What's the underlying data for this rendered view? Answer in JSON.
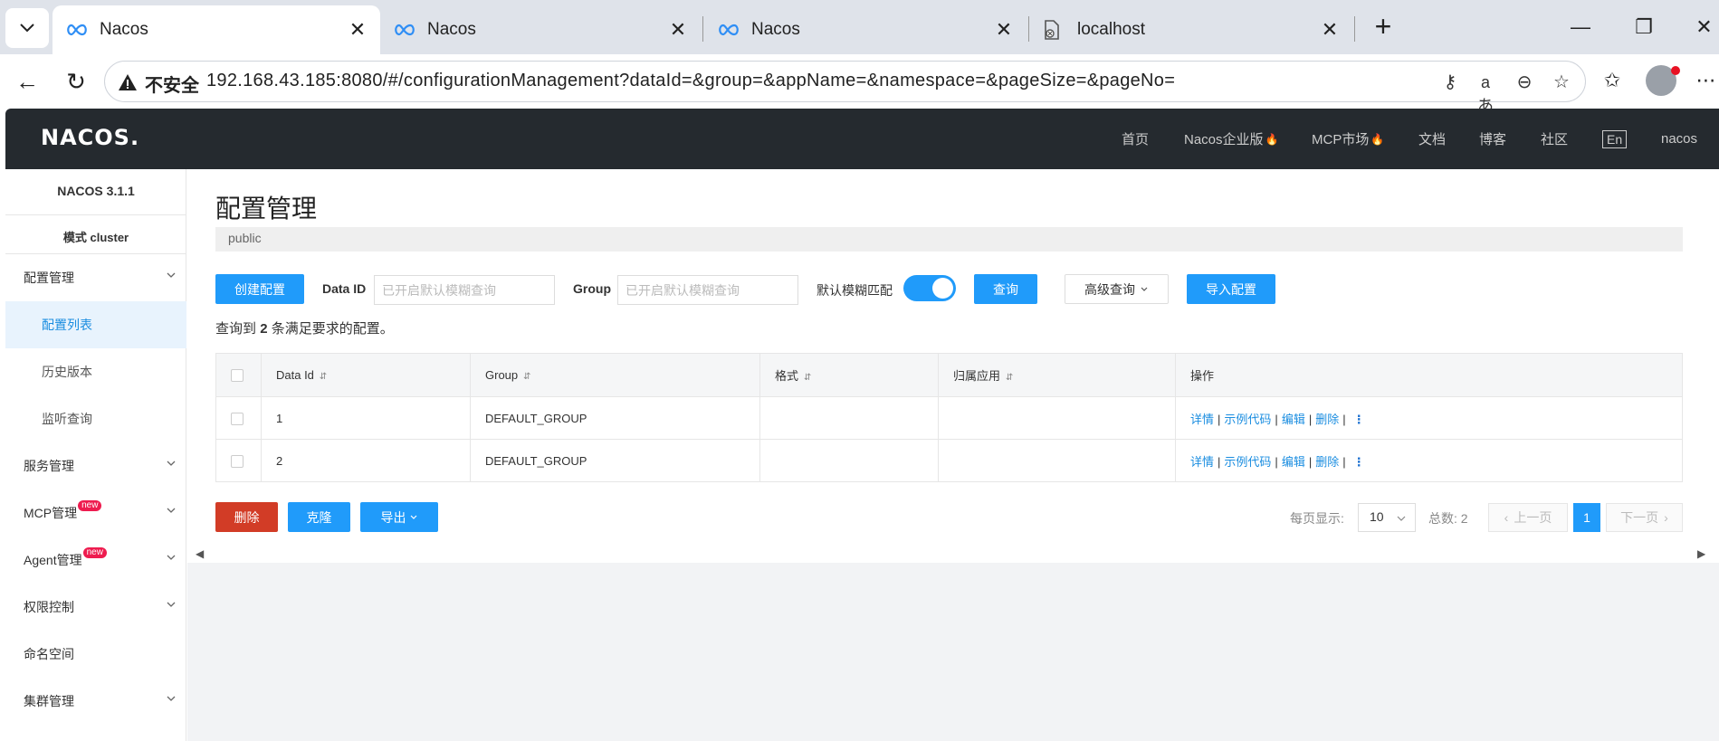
{
  "browser": {
    "tabs": [
      {
        "title": "Nacos",
        "active": true
      },
      {
        "title": "Nacos",
        "active": false
      },
      {
        "title": "Nacos",
        "active": false
      },
      {
        "title": "localhost",
        "active": false
      }
    ],
    "insecure_label": "不安全",
    "url": "192.168.43.185:8080/#/configurationManagement?dataId=&group=&appName=&namespace=&pageSize=&pageNo="
  },
  "header": {
    "logo": "NACOS.",
    "nav": [
      {
        "label": "首页",
        "fire": false
      },
      {
        "label": "Nacos企业版",
        "fire": true
      },
      {
        "label": "MCP市场",
        "fire": true
      },
      {
        "label": "文档",
        "fire": false
      },
      {
        "label": "博客",
        "fire": false
      },
      {
        "label": "社区",
        "fire": false
      }
    ],
    "lang": "En",
    "user": "nacos"
  },
  "sidebar": {
    "version": "NACOS 3.1.1",
    "mode": "模式 cluster",
    "items": [
      {
        "label": "配置管理",
        "expandable": true
      },
      {
        "label": "配置列表",
        "sub": true,
        "active": true
      },
      {
        "label": "历史版本",
        "sub": true
      },
      {
        "label": "监听查询",
        "sub": true
      },
      {
        "label": "服务管理",
        "expandable": true
      },
      {
        "label": "MCP管理",
        "expandable": true,
        "badge": "new"
      },
      {
        "label": "Agent管理",
        "expandable": true,
        "badge": "new"
      },
      {
        "label": "权限控制",
        "expandable": true
      },
      {
        "label": "命名空间"
      },
      {
        "label": "集群管理",
        "expandable": true
      }
    ]
  },
  "main": {
    "title": "配置管理",
    "namespace": "public",
    "toolbar": {
      "create_label": "创建配置",
      "dataid_label": "Data ID",
      "dataid_placeholder": "已开启默认模糊查询",
      "group_label": "Group",
      "group_placeholder": "已开启默认模糊查询",
      "fuzzy_label": "默认模糊匹配",
      "fuzzy_on": true,
      "query_label": "查询",
      "advanced_label": "高级查询",
      "import_label": "导入配置"
    },
    "result": {
      "prefix": "查询到",
      "count": "2",
      "suffix": "条满足要求的配置。"
    },
    "table": {
      "columns": [
        "Data Id",
        "Group",
        "格式",
        "归属应用",
        "操作"
      ],
      "rows": [
        {
          "data_id": "1",
          "group": "DEFAULT_GROUP",
          "format": "",
          "app": ""
        },
        {
          "data_id": "2",
          "group": "DEFAULT_GROUP",
          "format": "",
          "app": ""
        }
      ],
      "ops": [
        "详情",
        "示例代码",
        "编辑",
        "删除"
      ]
    },
    "bottom": {
      "delete_label": "删除",
      "clone_label": "克隆",
      "export_label": "导出"
    },
    "pager": {
      "per_page_label": "每页显示:",
      "per_page_value": "10",
      "total_label": "总数: 2",
      "prev_label": "上一页",
      "current": "1",
      "next_label": "下一页"
    }
  },
  "colors": {
    "primary": "#209bfa",
    "danger": "#d23c26",
    "header_bg": "#252a2f",
    "new_badge": "#ee1c4f"
  }
}
